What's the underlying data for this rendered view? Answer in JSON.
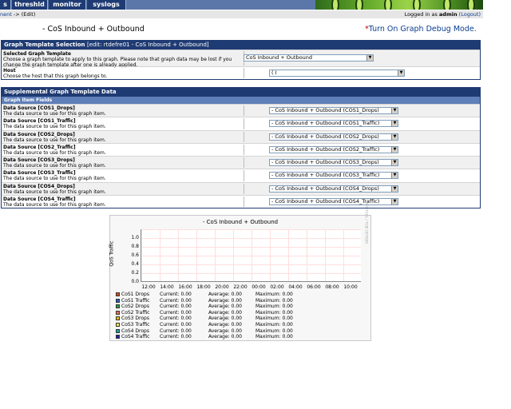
{
  "nav": {
    "tabs": [
      "s",
      "threshld",
      "monitor",
      "syslogs"
    ]
  },
  "breadcrumb": {
    "prefix": "nent",
    "separator": " -> ",
    "current": "(Edit)"
  },
  "login": {
    "prefix": "Logged in as ",
    "user": "admin",
    "logout": "(Logout)"
  },
  "page": {
    "title": "- CoS Inbound + Outbound",
    "debug_star": "*",
    "debug_label": "Turn On Graph Debug Mode."
  },
  "template_section": {
    "header": "Graph Template Selection",
    "header_sub": "[edit: rtdefre01 - CoS Inbound + Outbound]",
    "fields": [
      {
        "label": "Selected Graph Template",
        "desc": "Choose a graph template to apply to this graph. Please note that graph data may be lost if you change the graph template after one is already applied.",
        "value": "CoS Inbound + Outbound"
      },
      {
        "label": "Host",
        "desc": "Choose the host that this graph belongs to.",
        "value": "(          I"
      }
    ]
  },
  "supplemental_section": {
    "header": "Supplemental Graph Template Data",
    "subheader": "Graph Item Fields",
    "data_source_desc": "The data source to use for this graph item.",
    "items": [
      {
        "label": "Data Source [COS1_Drops]",
        "value": "- CoS Inbound + Outbound (COS1_Drops)"
      },
      {
        "label": "Data Source [COS1_Traffic]",
        "value": "- CoS Inbound + Outbound (COS1_Traffic)"
      },
      {
        "label": "Data Source [COS2_Drops]",
        "value": "- CoS Inbound + Outbound (COS2_Drops)"
      },
      {
        "label": "Data Source [COS2_Traffic]",
        "value": "- CoS Inbound + Outbound (COS2_Traffic)"
      },
      {
        "label": "Data Source [COS3_Drops]",
        "value": "- CoS Inbound + Outbound (COS3_Drops)"
      },
      {
        "label": "Data Source [COS3_Traffic]",
        "value": "- CoS Inbound + Outbound (COS3_Traffic)"
      },
      {
        "label": "Data Source [COS4_Drops]",
        "value": "- CoS Inbound + Outbound (COS4_Drops)"
      },
      {
        "label": "Data Source [COS4_Traffic]",
        "value": "- CoS Inbound + Outbound (COS4_Traffic)"
      }
    ]
  },
  "graph": {
    "title": "- CoS Inbound + Outbound",
    "ylabel": "QoS Traffic",
    "side_label": "RRDTOOL / TOBI OETIKER",
    "yticks": [
      "1.0",
      "0.8",
      "0.6",
      "0.4",
      "0.2",
      "0.0"
    ],
    "xticks": [
      "12:00",
      "14:00",
      "16:00",
      "18:00",
      "20:00",
      "22:00",
      "00:00",
      "02:00",
      "04:00",
      "06:00",
      "08:00",
      "10:00"
    ],
    "legend_labels": {
      "current": "Current:",
      "average": "Average:",
      "maximum": "Maximum:"
    },
    "legend": [
      {
        "name": "CoS1 Drops",
        "color": "#d05020",
        "current": "0.00",
        "average": "0.00",
        "maximum": "0.00"
      },
      {
        "name": "CoS1 Traffic",
        "color": "#2060c0",
        "current": "0.00",
        "average": "0.00",
        "maximum": "0.00"
      },
      {
        "name": "CoS2 Drops",
        "color": "#20a040",
        "current": "0.00",
        "average": "0.00",
        "maximum": "0.00"
      },
      {
        "name": "CoS2 Traffic",
        "color": "#e07060",
        "current": "0.00",
        "average": "0.00",
        "maximum": "0.00"
      },
      {
        "name": "CoS3 Drops",
        "color": "#e0c020",
        "current": "0.00",
        "average": "0.00",
        "maximum": "0.00"
      },
      {
        "name": "CoS3 Traffic",
        "color": "#f0e060",
        "current": "0.00",
        "average": "0.00",
        "maximum": "0.00"
      },
      {
        "name": "CoS4 Drops",
        "color": "#20a0a0",
        "current": "0.00",
        "average": "0.00",
        "maximum": "0.00"
      },
      {
        "name": "CoS4 Traffic",
        "color": "#2020a0",
        "current": "0.00",
        "average": "0.00",
        "maximum": "0.00"
      }
    ]
  }
}
